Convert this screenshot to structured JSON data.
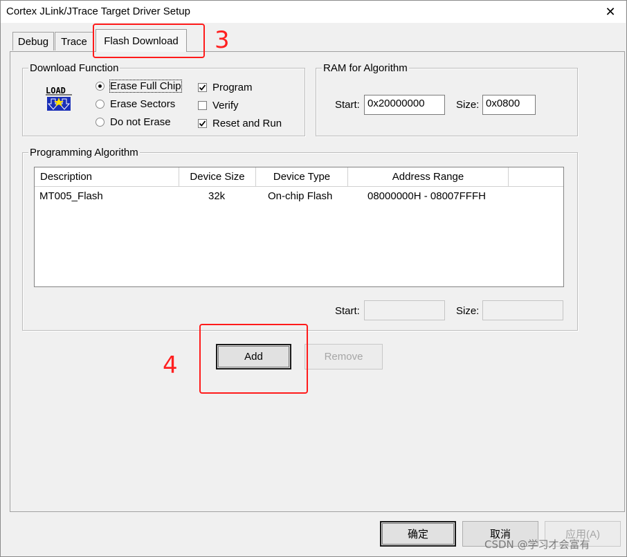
{
  "window": {
    "title": "Cortex JLink/JTrace Target Driver Setup",
    "close_glyph": "✕"
  },
  "tabs": [
    {
      "label": "Debug"
    },
    {
      "label": "Trace"
    },
    {
      "label": "Flash Download",
      "active": true
    }
  ],
  "download_function": {
    "title": "Download Function",
    "load_icon": "load-icon",
    "load_text": "LOAD",
    "radios": [
      {
        "label": "Erase Full Chip",
        "checked": true
      },
      {
        "label": "Erase Sectors",
        "checked": false
      },
      {
        "label": "Do not Erase",
        "checked": false
      }
    ],
    "checkboxes": [
      {
        "label": "Program",
        "checked": true
      },
      {
        "label": "Verify",
        "checked": false
      },
      {
        "label": "Reset and Run",
        "checked": true
      }
    ]
  },
  "ram": {
    "title": "RAM for Algorithm",
    "start_label": "Start:",
    "start_value": "0x20000000",
    "size_label": "Size:",
    "size_value": "0x0800"
  },
  "programming": {
    "title": "Programming Algorithm",
    "columns": [
      "Description",
      "Device Size",
      "Device Type",
      "Address Range"
    ],
    "rows": [
      {
        "description": "MT005_Flash",
        "size": "32k",
        "type": "On-chip Flash",
        "range": "08000000H - 08007FFFH"
      }
    ],
    "start_label": "Start:",
    "start_value": "",
    "size_label": "Size:",
    "size_value": ""
  },
  "buttons": {
    "add": "Add",
    "remove": "Remove",
    "ok": "确定",
    "cancel": "取消",
    "apply": "应用(A)"
  },
  "annotations": {
    "tab_marker": "3",
    "add_marker": "4",
    "color": "#ff1a1a"
  },
  "watermark": "CSDN @学习才会富有"
}
